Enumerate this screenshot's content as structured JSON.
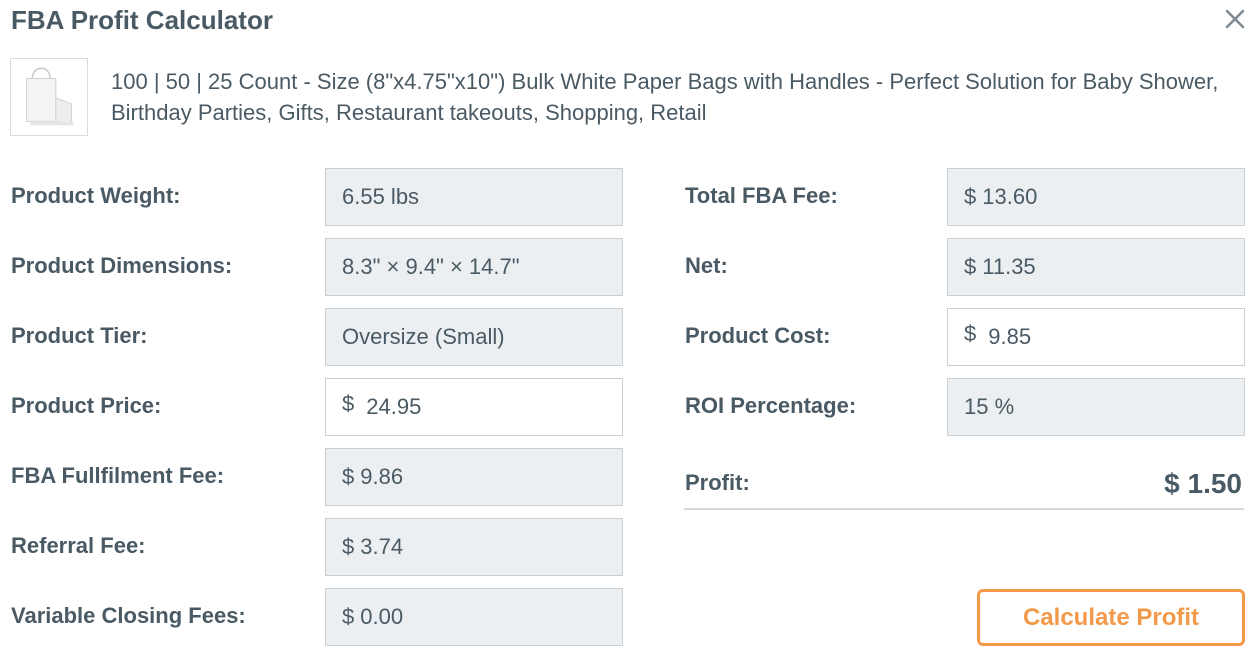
{
  "header": {
    "title": "FBA Profit Calculator",
    "close_icon": "close-icon"
  },
  "product": {
    "thumbnail_icon": "paper-bag-image",
    "title": "100 | 50 | 25 Count - Size (8\"x4.75\"x10\") Bulk White Paper Bags with Handles - Perfect Solution for Baby Shower, Birthday Parties, Gifts, Restaurant takeouts, Shopping, Retail"
  },
  "left_fields": {
    "weight": {
      "label": "Product Weight:",
      "value": "6.55 lbs"
    },
    "dimensions": {
      "label": "Product Dimensions:",
      "value": "8.3\" × 9.4\" × 14.7\""
    },
    "tier": {
      "label": "Product Tier:",
      "value": "Oversize (Small)"
    },
    "price": {
      "label": "Product Price:",
      "currency": "$",
      "value": "24.95"
    },
    "fulfilment_fee": {
      "label": "FBA Fullfilment Fee:",
      "currency": "$",
      "value": "9.86"
    },
    "referral_fee": {
      "label": "Referral Fee:",
      "currency": "$",
      "value": "3.74"
    },
    "closing_fee": {
      "label": "Variable Closing Fees:",
      "currency": "$",
      "value": "0.00"
    }
  },
  "right_fields": {
    "total_fba_fee": {
      "label": "Total FBA Fee:",
      "currency": "$",
      "value": "13.60"
    },
    "net": {
      "label": "Net:",
      "currency": "$",
      "value": "11.35"
    },
    "product_cost": {
      "label": "Product Cost:",
      "currency": "$",
      "value": "9.85"
    },
    "roi": {
      "label": "ROI Percentage:",
      "value": "15 %"
    }
  },
  "profit": {
    "label": "Profit:",
    "value": "$ 1.50"
  },
  "actions": {
    "calculate_label": "Calculate Profit"
  },
  "colors": {
    "accent": "#f2994a",
    "text": "#4a5a64",
    "readonly_bg": "#eceff1",
    "border": "#c9cfd3"
  }
}
